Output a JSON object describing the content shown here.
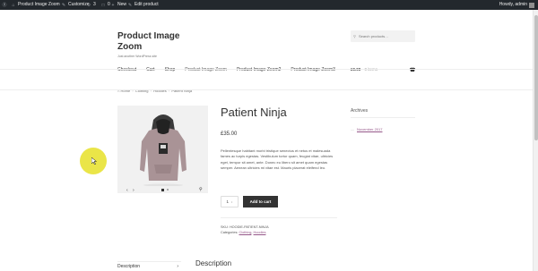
{
  "admin_bar": {
    "site_name": "Product Image Zoom",
    "customize": "Customize",
    "updates_count": "3",
    "comments_count": "0",
    "new_label": "New",
    "edit_label": "Edit product",
    "howdy": "Howdy, admin"
  },
  "site": {
    "title": "Product Image Zoom",
    "tagline": "Just another WordPress site"
  },
  "search": {
    "placeholder": "Search products…"
  },
  "nav": {
    "items": [
      "Checkout",
      "Cart",
      "Shop",
      "Product Image Zoom",
      "Product Image Zoom2",
      "Product Image Zoom3"
    ]
  },
  "cart": {
    "amount": "£0.00",
    "items": "0 items"
  },
  "breadcrumb": {
    "items": [
      "Home",
      "Clothing",
      "Hoodies",
      "Patient Ninja"
    ]
  },
  "product": {
    "title": "Patient Ninja",
    "price": "£35.00",
    "description": "Pellentesque habitant morbi tristique senectus et netus et malesuada fames ac turpis egestas. Vestibulum tortor quam, feugiat vitae, ultricies eget, tempor sit amet, ante. Donec eu libero sit amet quam egestas semper. Aenean ultricies mi vitae est. Mauris placerat eleifend leo.",
    "quantity": "1",
    "add_to_cart": "Add to cart",
    "sku_label": "SKU:",
    "sku": "HOODIE-PATIENT-NINJA",
    "categories_label": "Categories:",
    "categories": [
      "Clothing",
      "Hoodies"
    ]
  },
  "sidebar": {
    "archives_title": "Archives",
    "archive_link": "November 2017"
  },
  "tabs": {
    "description_tab": "Description",
    "description_heading": "Description"
  },
  "colors": {
    "admin_bar": "#23282d",
    "accent_link": "#96588a",
    "button": "#333333",
    "cursor_highlight": "#e6e128"
  },
  "icons": [
    "wordpress-icon",
    "home-icon",
    "brush-icon",
    "updates-icon",
    "comment-icon",
    "plus-icon",
    "pencil-icon",
    "search-icon",
    "basket-icon",
    "zoom-icon",
    "arrow-left-icon",
    "arrow-right-icon",
    "chevron-right-icon"
  ]
}
